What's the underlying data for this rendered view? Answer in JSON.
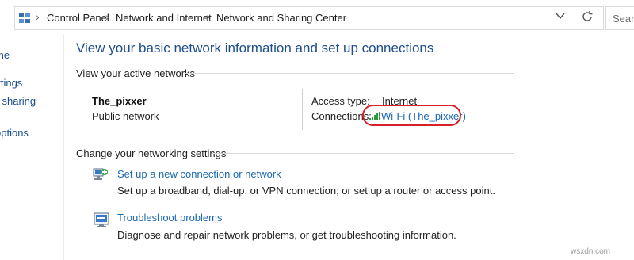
{
  "address_bar": {
    "breadcrumbs": [
      "Control Panel",
      "Network and Internet",
      "Network and Sharing Center"
    ],
    "search_placeholder": "Search"
  },
  "left_pane": {
    "items": [
      "me",
      "ettings",
      "l sharing",
      "options"
    ]
  },
  "main": {
    "title": "View your basic network information and set up connections",
    "active_networks_label": "View your active networks",
    "network": {
      "name": "The_pixxer",
      "category": "Public network",
      "access_type_label": "Access type:",
      "access_type_value": "Internet",
      "connections_label": "Connections:",
      "connection_link": "Wi-Fi (The_pixxer)"
    },
    "change_settings_label": "Change your networking settings",
    "tasks": [
      {
        "icon": "network-setup-icon",
        "link": "Set up a new connection or network",
        "description": "Set up a broadband, dial-up, or VPN connection; or set up a router or access point."
      },
      {
        "icon": "troubleshoot-icon",
        "link": "Troubleshoot problems",
        "description": "Diagnose and repair network problems, or get troubleshooting information."
      }
    ]
  },
  "watermark": "wsxdn.com",
  "colors": {
    "title_blue": "#1e4e8c",
    "link_blue": "#1a68b5",
    "highlight_red": "#d8202a"
  }
}
